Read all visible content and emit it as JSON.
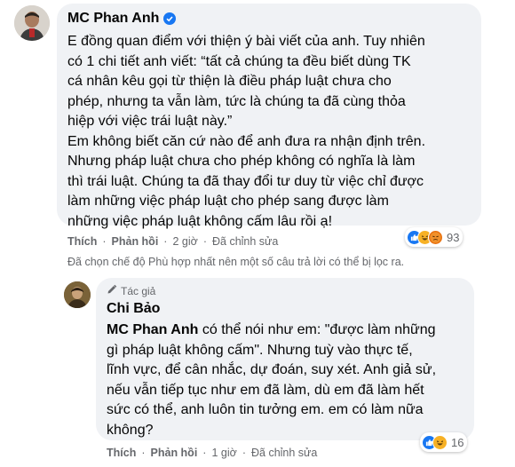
{
  "comment": {
    "author": "MC Phan Anh",
    "text": "E đồng quan điểm với thiện ý bài viết của anh. Tuy nhiên\ncó 1 chi tiết anh viết: “tất cả chúng ta đều biết dùng TK\ncá nhân kêu gọi từ thiện là điều pháp luật chưa cho\nphép, nhưng ta vẫn làm, tức là chúng ta đã cùng thỏa\nhiệp với việc trái luật này.”\nEm không biết căn cứ nào để anh đưa ra nhận định trên.\nNhưng pháp luật chưa cho phép không có nghĩa là làm\nthì trái luật. Chúng ta đã thay đổi tư duy từ việc chỉ được\nlàm những việc pháp luật cho phép sang được làm\nnhững việc pháp luật không cấm lâu rồi ạ!",
    "like": "Thích",
    "reply": "Phản hồi",
    "time": "2 giờ",
    "edited": "Đã chỉnh sửa",
    "reaction_count": "93"
  },
  "filter_note": "Đã chọn chế độ Phù hợp nhất nên một số câu trả lời có thể bị lọc ra.",
  "reply": {
    "author_tag": "Tác giả",
    "author": "Chi Bảo",
    "mention": "MC Phan Anh",
    "text": " có thể nói như em: \"được làm những\ngì pháp luật không cấm\". Nhưng tuỳ vào thực tế,\nlĩnh vực, để cân nhắc, dự đoán, suy xét. Anh giả sử,\nnếu vẫn tiếp tục như em đã làm, dù em đã làm hết\nsức có thể, anh luôn tin tưởng em. em có làm nữa\nkhông?",
    "like": "Thích",
    "reply": "Phản hồi",
    "time": "1 giờ",
    "edited": "Đã chỉnh sửa",
    "reaction_count": "16"
  },
  "colors": {
    "verified": "#1877f2",
    "meta": "#65676b",
    "bubble": "#f0f2f5"
  },
  "icons": [
    "verified-badge-icon",
    "pencil-icon",
    "like-reaction-icon",
    "haha-reaction-icon",
    "angry-reaction-icon"
  ]
}
